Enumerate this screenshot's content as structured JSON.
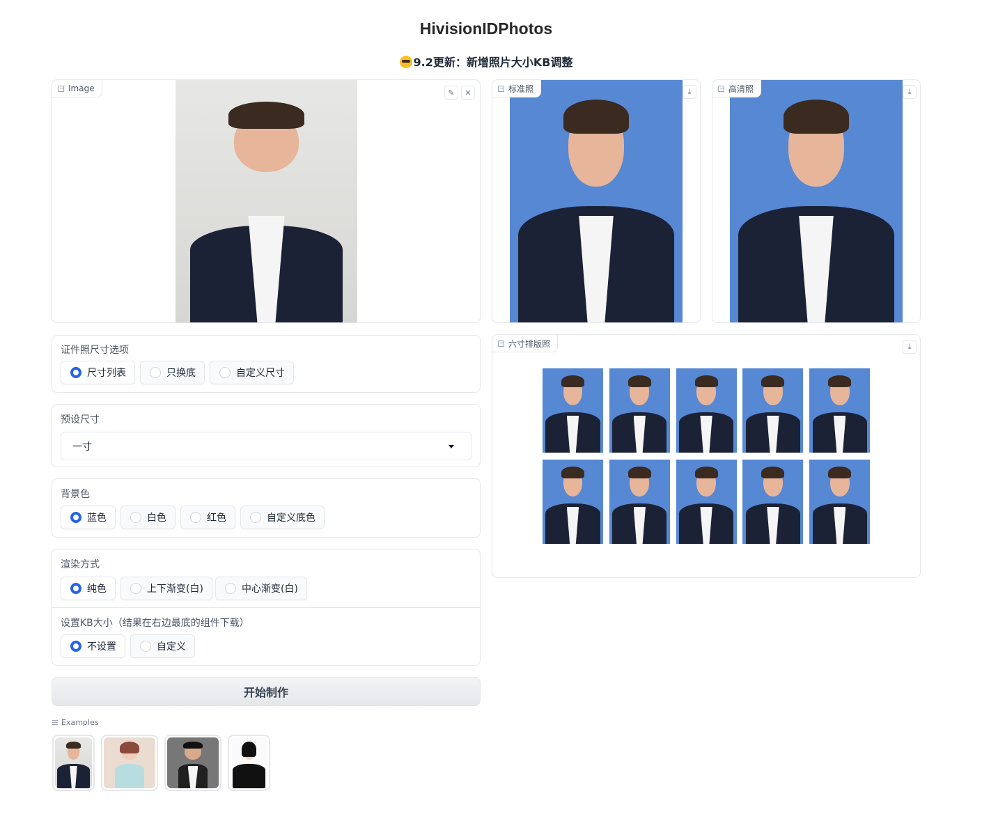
{
  "header": {
    "title": "HivisionIDPhotos",
    "subtitle": "9.2更新：新增照片大小KB调整"
  },
  "input_image": {
    "label": "Image"
  },
  "outputs": {
    "standard": {
      "label": "标准照"
    },
    "hd": {
      "label": "高清照"
    },
    "layout": {
      "label": "六寸排版照"
    }
  },
  "size_option": {
    "label": "证件照尺寸选项",
    "options": [
      "尺寸列表",
      "只换底",
      "自定义尺寸"
    ],
    "selected": "尺寸列表"
  },
  "preset_size": {
    "label": "预设尺寸",
    "value": "一寸"
  },
  "bg_color": {
    "label": "背景色",
    "options": [
      "蓝色",
      "白色",
      "红色",
      "自定义底色"
    ],
    "selected": "蓝色"
  },
  "render_mode": {
    "label": "渲染方式",
    "options": [
      "纯色",
      "上下渐变(白)",
      "中心渐变(白)"
    ],
    "selected": "纯色"
  },
  "kb_size": {
    "label": "设置KB大小（结果在右边最底的组件下载）",
    "options": [
      "不设置",
      "自定义"
    ],
    "selected": "不设置"
  },
  "submit": {
    "label": "开始制作"
  },
  "examples": {
    "label": "Examples"
  },
  "colors": {
    "accent": "#2563eb",
    "photo_bg_blue": "#5688d4"
  }
}
